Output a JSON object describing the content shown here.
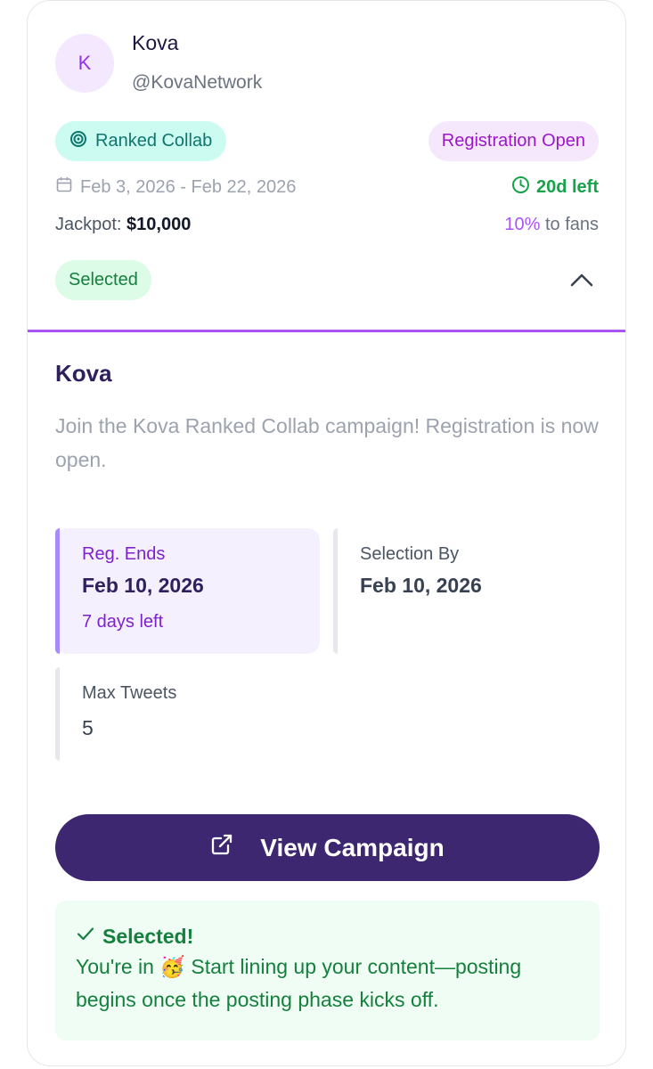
{
  "header": {
    "avatar_letter": "K",
    "name": "Kova",
    "handle": "@KovaNetwork",
    "type_label": "Ranked Collab",
    "status_label": "Registration Open",
    "date_range": "Feb 3, 2026 - Feb 22, 2026",
    "time_left": "20d left",
    "jackpot_label": "Jackpot:",
    "jackpot_value": "$10,000",
    "fans_pct": "10%",
    "fans_suffix": "to fans",
    "selected_label": "Selected"
  },
  "details": {
    "title": "Kova",
    "description": "Join the Kova Ranked Collab campaign! Registration is now open.",
    "reg_ends_label": "Reg. Ends",
    "reg_ends_value": "Feb 10, 2026",
    "reg_ends_days_left": "7 days left",
    "selection_by_label": "Selection By",
    "selection_by_value": "Feb 10, 2026",
    "max_tweets_label": "Max Tweets",
    "max_tweets_value": "5",
    "cta_label": "View Campaign"
  },
  "notice": {
    "title": "Selected!",
    "body": "You're in 🥳 Start lining up your content—posting begins once the posting phase kicks off."
  },
  "colors": {
    "accent_purple": "#a855f7",
    "cta_bg": "#3c2770",
    "success_green": "#15803d",
    "teal": "#0f766e"
  },
  "icons": [
    "target-icon",
    "calendar-icon",
    "clock-icon",
    "chevron-up-icon",
    "external-link-icon",
    "check-icon"
  ]
}
